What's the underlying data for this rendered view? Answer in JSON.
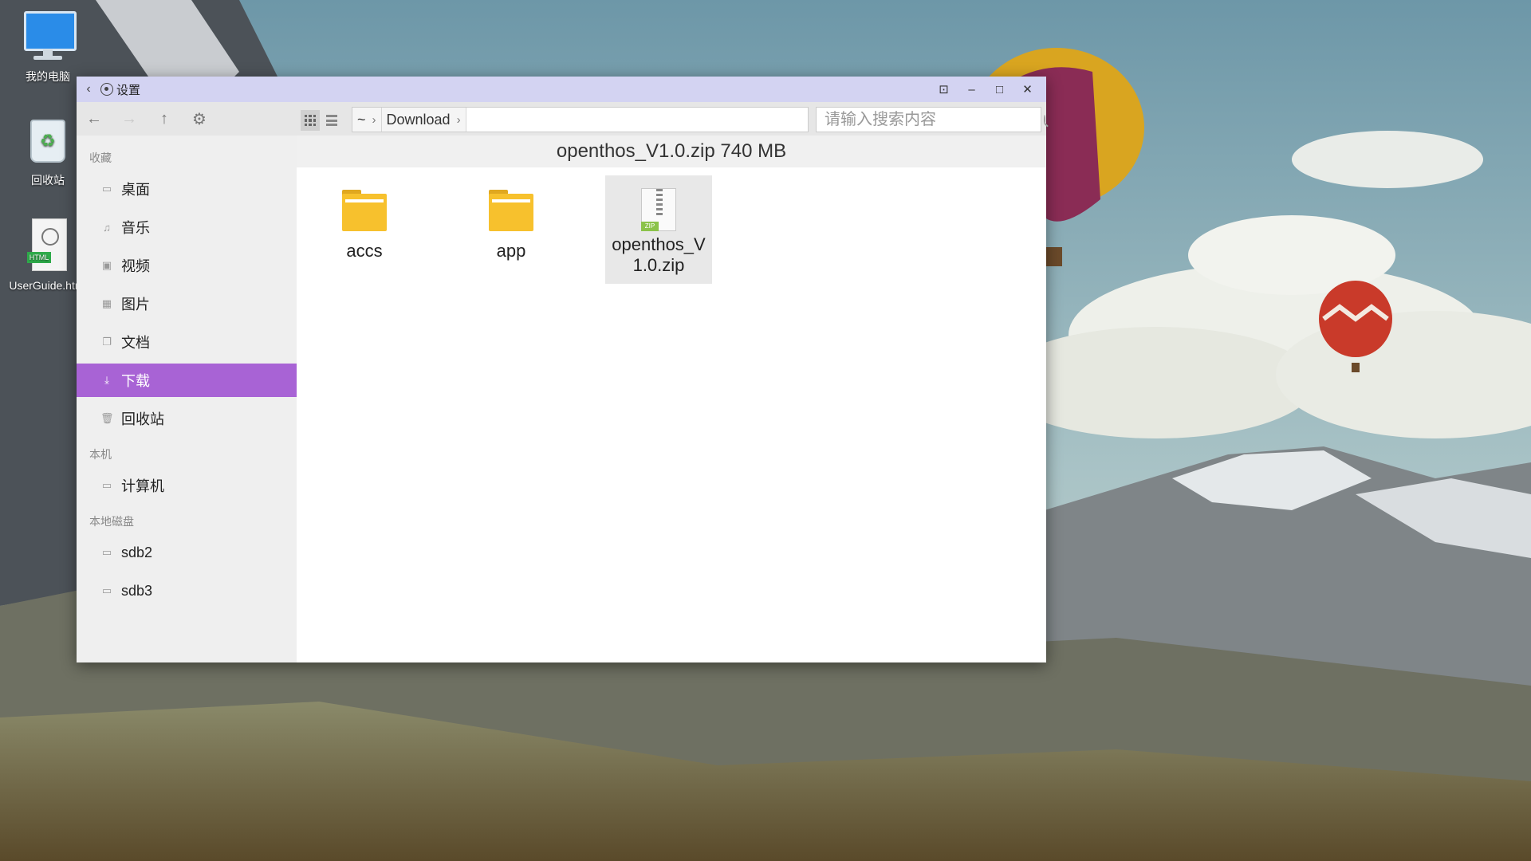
{
  "desktop": {
    "icons": [
      {
        "label": "我的电脑"
      },
      {
        "label": "回收站"
      },
      {
        "label": "UserGuide.html"
      }
    ]
  },
  "window": {
    "title": "设置",
    "controls": {
      "lock": "lock-icon",
      "minimize": "–",
      "maximize": "□",
      "close": "✕"
    }
  },
  "toolbar": {
    "path": [
      {
        "label": "~"
      },
      {
        "label": "Download"
      }
    ],
    "search_placeholder": "请输入搜索内容"
  },
  "sidebar": {
    "groups": [
      {
        "label": "收藏"
      },
      {
        "label": "本机"
      },
      {
        "label": "本地磁盘"
      }
    ],
    "items": [
      {
        "label": "桌面"
      },
      {
        "label": "音乐"
      },
      {
        "label": "视频"
      },
      {
        "label": "图片"
      },
      {
        "label": "文档"
      },
      {
        "label": "下载"
      },
      {
        "label": "回收站"
      },
      {
        "label": "计算机"
      },
      {
        "label": "sdb2"
      },
      {
        "label": "sdb3"
      }
    ]
  },
  "status": {
    "selected_info": "openthos_V1.0.zip 740 MB"
  },
  "files": [
    {
      "name": "accs",
      "type": "folder"
    },
    {
      "name": "app",
      "type": "folder"
    },
    {
      "name": "openthos_V1.0.zip",
      "type": "zip",
      "icon_tag": "ZIP"
    }
  ],
  "colors": {
    "accent": "#a863d5",
    "titlebar": "#d3d3f2"
  }
}
